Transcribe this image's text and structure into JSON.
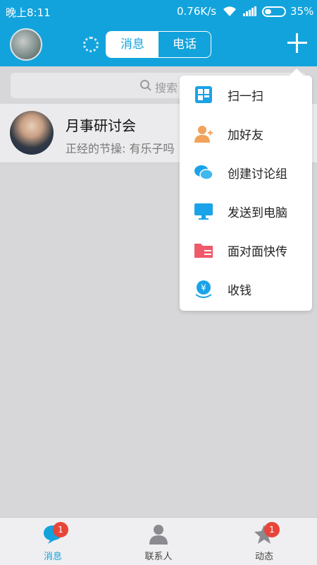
{
  "status_bar": {
    "time": "晚上8:11",
    "network_speed": "0.76K/s",
    "battery_percent": "35%"
  },
  "header": {
    "tabs": [
      "消息",
      "电话"
    ],
    "active_tab": "消息",
    "add_icon": "plus-icon"
  },
  "search": {
    "placeholder": "搜索"
  },
  "chats": [
    {
      "name": "月事研讨会",
      "preview": "正经的节操: 有乐子吗"
    }
  ],
  "menu": {
    "items": [
      {
        "label": "扫一扫",
        "icon": "scan-icon"
      },
      {
        "label": "加好友",
        "icon": "add-friend-icon"
      },
      {
        "label": "创建讨论组",
        "icon": "group-chat-icon"
      },
      {
        "label": "发送到电脑",
        "icon": "computer-icon"
      },
      {
        "label": "面对面快传",
        "icon": "folder-transfer-icon"
      },
      {
        "label": "收钱",
        "icon": "yuan-icon"
      }
    ]
  },
  "bottom_nav": {
    "tabs": [
      {
        "label": "消息",
        "badge": "1",
        "active": true
      },
      {
        "label": "联系人",
        "badge": "",
        "active": false
      },
      {
        "label": "动态",
        "badge": "1",
        "active": false
      }
    ]
  },
  "colors": {
    "brand": "#12a3dc",
    "badge": "#e8453a",
    "menu_accent": "#1aa3e8"
  }
}
